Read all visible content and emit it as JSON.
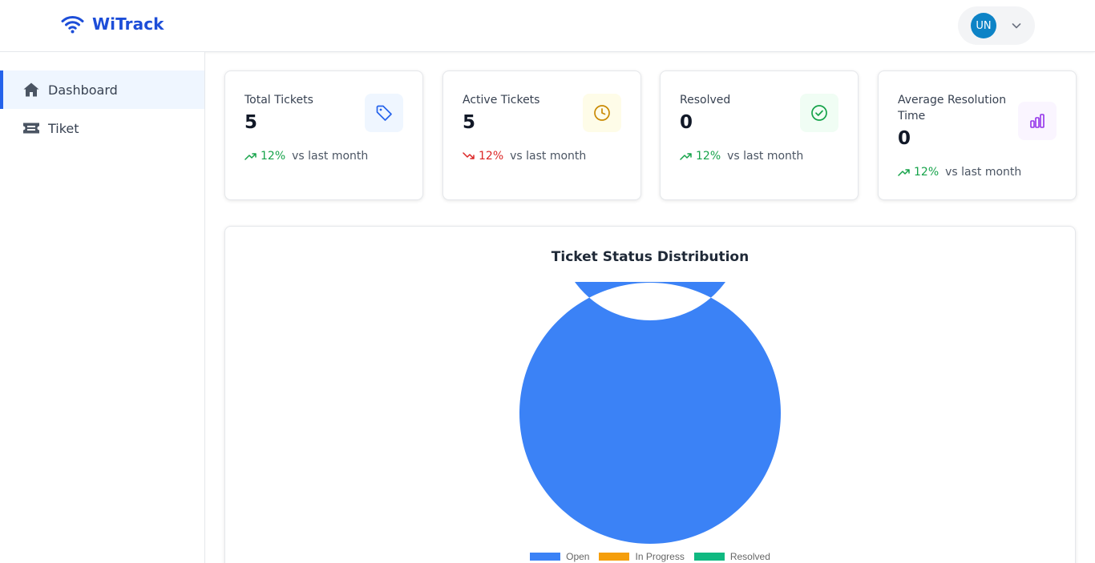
{
  "app": {
    "name": "WiTrack",
    "logo_icon": "wifi-icon"
  },
  "header": {
    "user_initials": "UN",
    "menu_icon": "chevron-down-icon"
  },
  "sidebar": {
    "items": [
      {
        "label": "Dashboard",
        "icon": "home-icon",
        "active": true
      },
      {
        "label": "Tiket",
        "icon": "ticket-icon",
        "active": false
      }
    ]
  },
  "stats": [
    {
      "label": "Total Tickets",
      "value": "5",
      "trend_pct": "12%",
      "trend_direction": "up",
      "trend_note": "vs last month",
      "icon": "tag-icon",
      "color": "#2563eb",
      "badge_bg": "#eff6ff"
    },
    {
      "label": "Active Tickets",
      "value": "5",
      "trend_pct": "12%",
      "trend_direction": "down",
      "trend_note": "vs last month",
      "icon": "clock-icon",
      "color": "#ca8a04",
      "badge_bg": "#fefce8"
    },
    {
      "label": "Resolved",
      "value": "0",
      "trend_pct": "12%",
      "trend_direction": "up",
      "trend_note": "vs last month",
      "icon": "check-circle-icon",
      "color": "#16a34a",
      "badge_bg": "#f0fdf4"
    },
    {
      "label": "Average Resolution Time",
      "value": "0",
      "trend_pct": "12%",
      "trend_direction": "up",
      "trend_note": "vs last month",
      "icon": "bar-chart-icon",
      "color": "#9333ea",
      "badge_bg": "#faf5ff"
    }
  ],
  "chart_data": {
    "type": "pie",
    "title": "Ticket Status Distribution",
    "categories": [
      "Open",
      "In Progress",
      "Resolved"
    ],
    "values": [
      5,
      0,
      0
    ],
    "colors": [
      "#3b82f6",
      "#f59e0b",
      "#10b981"
    ],
    "legend_position": "bottom"
  }
}
